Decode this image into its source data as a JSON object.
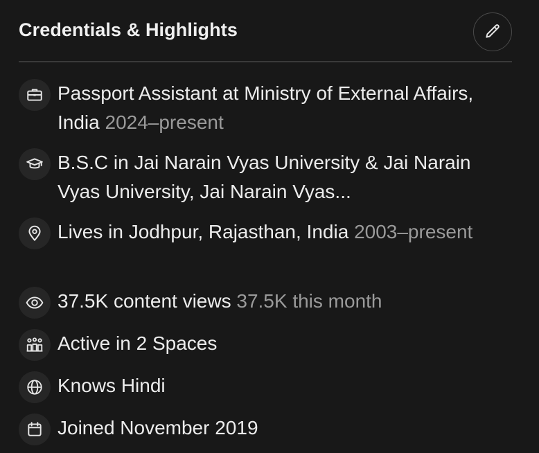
{
  "header": {
    "title": "Credentials & Highlights",
    "edit_icon": "pencil-icon"
  },
  "items": [
    {
      "icon": "briefcase-icon",
      "primary": "Passport Assistant at Ministry of External Affairs, India",
      "secondary": "2024–present"
    },
    {
      "icon": "graduation-cap-icon",
      "primary": "B.S.C in Jai Narain Vyas University & Jai Narain Vyas University, Jai Narain Vyas...",
      "secondary": ""
    },
    {
      "icon": "location-pin-icon",
      "primary": "Lives in Jodhpur, Rajasthan, India",
      "secondary": "2003–present"
    },
    {
      "icon": "eye-icon",
      "primary": "37.5K content views",
      "secondary": "37.5K this month"
    },
    {
      "icon": "people-icon",
      "primary": "Active in 2 Spaces",
      "secondary": ""
    },
    {
      "icon": "globe-icon",
      "primary": "Knows Hindi",
      "secondary": ""
    },
    {
      "icon": "calendar-icon",
      "primary": "Joined November 2019",
      "secondary": ""
    }
  ]
}
